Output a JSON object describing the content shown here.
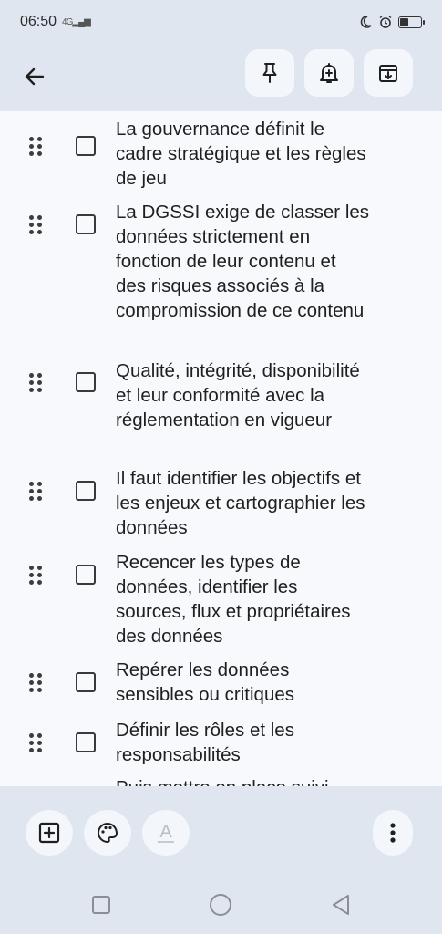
{
  "status": {
    "time": "06:50",
    "network": "4G"
  },
  "toolbar": {
    "back_icon": "arrow-left-icon",
    "pin_icon": "pin-icon",
    "reminder_icon": "bell-plus-icon",
    "archive_icon": "archive-icon"
  },
  "items": [
    {
      "text": "La gouvernance définit le cadre stratégique et les règles de jeu",
      "checked": false
    },
    {
      "text": "La DGSSI exige de classer les données strictement en fonction de leur contenu et des risques associés à la compromission de ce contenu",
      "checked": false
    },
    {
      "text": "Qualité, intégrité, disponibilité et leur conformité avec la réglementation en vigueur",
      "checked": false
    },
    {
      "text": "Il faut identifier les objectifs et les enjeux et cartographier les données",
      "checked": false
    },
    {
      "text": "Recencer les types de données, identifier les sources, flux et propriétaires des données",
      "checked": false
    },
    {
      "text": "Repérer les données sensibles ou critiques",
      "checked": false
    },
    {
      "text": "Définir les rôles et les responsabilités",
      "checked": false
    },
    {
      "text": "Puis mettre en place suivi",
      "checked": false
    }
  ],
  "bottom": {
    "add_icon": "add-box-icon",
    "palette_icon": "palette-icon",
    "text_format_icon": "text-format-icon",
    "text_format_label": "A",
    "more_icon": "more-vert-icon"
  },
  "nav": {
    "recent_icon": "square-icon",
    "home_icon": "circle-icon",
    "back_icon": "triangle-back-icon"
  }
}
